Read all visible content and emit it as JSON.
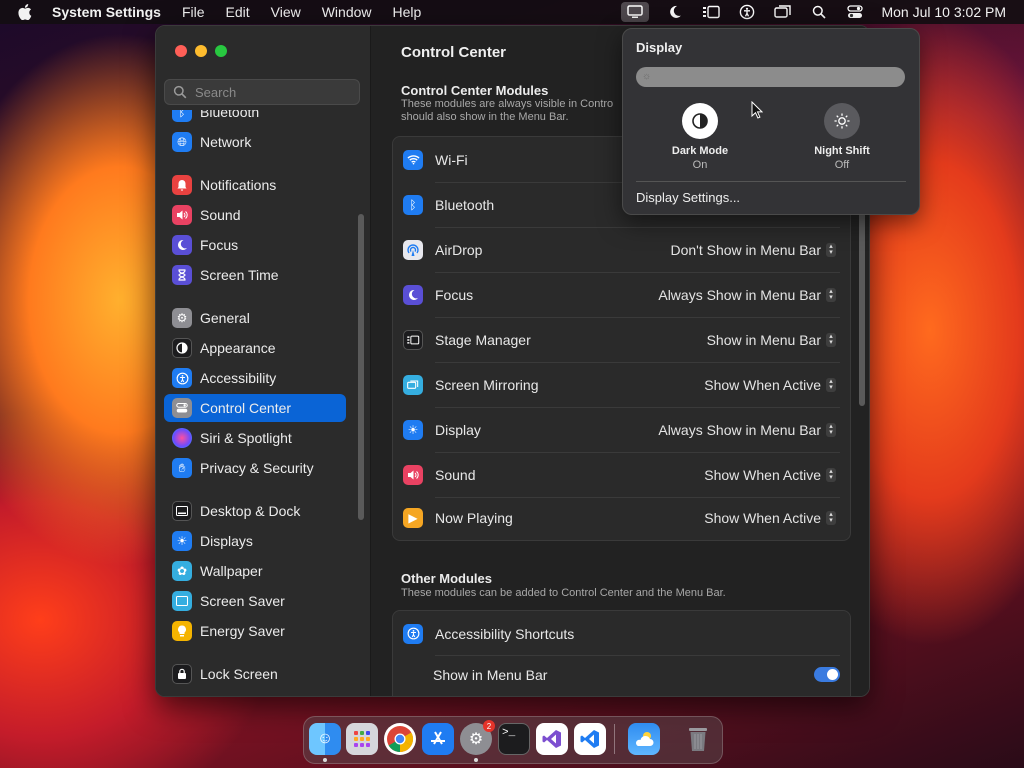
{
  "menubar": {
    "app_name": "System Settings",
    "menus": [
      "File",
      "Edit",
      "View",
      "Window",
      "Help"
    ],
    "clock": "Mon Jul 10  3:02 PM"
  },
  "sidebar": {
    "search_placeholder": "Search",
    "items": [
      {
        "label": "Bluetooth",
        "icon": "bluetooth-icon",
        "color": "#1f7cf2"
      },
      {
        "label": "Network",
        "icon": "globe-icon",
        "color": "#1f7cf2"
      },
      {
        "label": "Notifications",
        "icon": "bell-icon",
        "color": "#e94240"
      },
      {
        "label": "Sound",
        "icon": "speaker-icon",
        "color": "#e94262"
      },
      {
        "label": "Focus",
        "icon": "moon-icon",
        "color": "#5a4fd6"
      },
      {
        "label": "Screen Time",
        "icon": "hourglass-icon",
        "color": "#5a4fd6"
      },
      {
        "label": "General",
        "icon": "gear-icon",
        "color": "#8e8e93"
      },
      {
        "label": "Appearance",
        "icon": "appearance-icon",
        "color": "#1c1c1e"
      },
      {
        "label": "Accessibility",
        "icon": "accessibility-icon",
        "color": "#1f7cf2"
      },
      {
        "label": "Control Center",
        "icon": "control-center-icon",
        "color": "#8e8e93"
      },
      {
        "label": "Siri & Spotlight",
        "icon": "siri-icon",
        "color": "#b04cd9"
      },
      {
        "label": "Privacy & Security",
        "icon": "hand-icon",
        "color": "#1f7cf2"
      },
      {
        "label": "Desktop & Dock",
        "icon": "dock-icon",
        "color": "#1c1c1e"
      },
      {
        "label": "Displays",
        "icon": "sun-icon",
        "color": "#1f7cf2"
      },
      {
        "label": "Wallpaper",
        "icon": "flower-icon",
        "color": "#35aee0"
      },
      {
        "label": "Screen Saver",
        "icon": "screensaver-icon",
        "color": "#35aee0"
      },
      {
        "label": "Energy Saver",
        "icon": "bulb-icon",
        "color": "#f5b400"
      },
      {
        "label": "Lock Screen",
        "icon": "lock-icon",
        "color": "#1c1c1e"
      }
    ],
    "selected": "Control Center"
  },
  "main": {
    "title": "Control Center",
    "modules_heading": "Control Center Modules",
    "modules_sub": "These modules are always visible in Control Center. You can choose if they should also show in the Menu Bar.",
    "modules_sub_line1": "These modules are always visible in Contro",
    "modules_sub_line2": "should also show in the Menu Bar.",
    "modules": [
      {
        "label": "Wi-Fi",
        "icon": "wifi-icon",
        "color": "#1f7cf2",
        "value": ""
      },
      {
        "label": "Bluetooth",
        "icon": "bluetooth-icon",
        "color": "#1f7cf2",
        "value": ""
      },
      {
        "label": "AirDrop",
        "icon": "airdrop-icon",
        "color": "#e8e8ee",
        "value": "Don't Show in Menu Bar"
      },
      {
        "label": "Focus",
        "icon": "moon-icon",
        "color": "#5a4fd6",
        "value": "Always Show in Menu Bar"
      },
      {
        "label": "Stage Manager",
        "icon": "stage-manager-icon",
        "color": "#1c1c1e",
        "value": "Show in Menu Bar"
      },
      {
        "label": "Screen Mirroring",
        "icon": "screen-mirroring-icon",
        "color": "#35aee0",
        "value": "Show When Active"
      },
      {
        "label": "Display",
        "icon": "sun-icon",
        "color": "#1f7cf2",
        "value": "Always Show in Menu Bar"
      },
      {
        "label": "Sound",
        "icon": "speaker-icon",
        "color": "#e94262",
        "value": "Show When Active"
      },
      {
        "label": "Now Playing",
        "icon": "play-icon",
        "color": "#f5a623",
        "value": "Show When Active"
      }
    ],
    "other_heading": "Other Modules",
    "other_sub": "These modules can be added to Control Center and the Menu Bar.",
    "other": {
      "accessibility_label": "Accessibility Shortcuts",
      "show_in_menu_bar_label": "Show in Menu Bar",
      "show_in_menu_bar_on": true
    }
  },
  "popover": {
    "title": "Display",
    "brightness": 0.0,
    "dark_mode": {
      "label": "Dark Mode",
      "state": "On"
    },
    "night_shift": {
      "label": "Night Shift",
      "state": "Off"
    },
    "link": "Display Settings..."
  },
  "dock": {
    "apps": [
      {
        "name": "Finder",
        "icon": "finder-icon",
        "color": "#2f8cf0",
        "running": true
      },
      {
        "name": "Launchpad",
        "icon": "launchpad-icon",
        "color": "#cfcfd4",
        "running": false
      },
      {
        "name": "Chrome",
        "icon": "chrome-icon",
        "color": "#ffffff",
        "running": false
      },
      {
        "name": "App Store",
        "icon": "app-store-icon",
        "color": "#1f7cf2",
        "running": false
      },
      {
        "name": "System Settings",
        "icon": "gear-icon",
        "color": "#8e8e93",
        "running": true,
        "badge": "2"
      },
      {
        "name": "Terminal",
        "icon": "terminal-icon",
        "color": "#1c1c1e",
        "running": false
      },
      {
        "name": "Visual Studio",
        "icon": "visual-studio-icon",
        "color": "#7c4fd0",
        "running": false
      },
      {
        "name": "VS Code",
        "icon": "vscode-icon",
        "color": "#1f7cf2",
        "running": false
      },
      {
        "name": "Weather",
        "icon": "weather-icon",
        "color": "#2f8cf0",
        "running": false
      },
      {
        "name": "Trash",
        "icon": "trash-icon",
        "color": "#6e6e73",
        "running": false
      }
    ]
  }
}
